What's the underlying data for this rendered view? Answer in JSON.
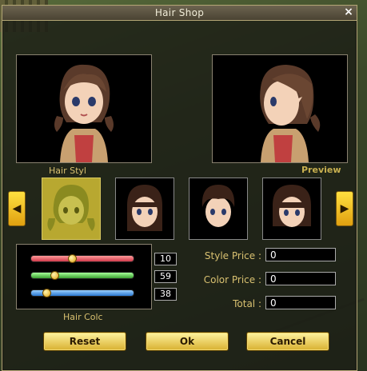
{
  "window": {
    "title": "Hair Shop",
    "close_icon": "×"
  },
  "labels": {
    "hair_style": "Hair Styl",
    "preview": "Preview",
    "hair_color": "Hair Colc"
  },
  "color_values": {
    "red": "10",
    "green": "59",
    "blue": "38"
  },
  "color_levels": {
    "red": 0.4,
    "green": 0.23,
    "blue": 0.15
  },
  "prices": {
    "style_label": "Style Price :",
    "style_value": "0",
    "color_label": "Color Price :",
    "color_value": "0",
    "total_label": "Total :",
    "total_value": "0"
  },
  "buttons": {
    "reset": "Reset",
    "ok": "Ok",
    "cancel": "Cancel"
  },
  "arrows": {
    "left": "◀",
    "right": "▶"
  },
  "colors": {
    "accent_gold": "#d8c070",
    "selected_thumb": "#b8a830",
    "window_border": "#b3a675"
  }
}
